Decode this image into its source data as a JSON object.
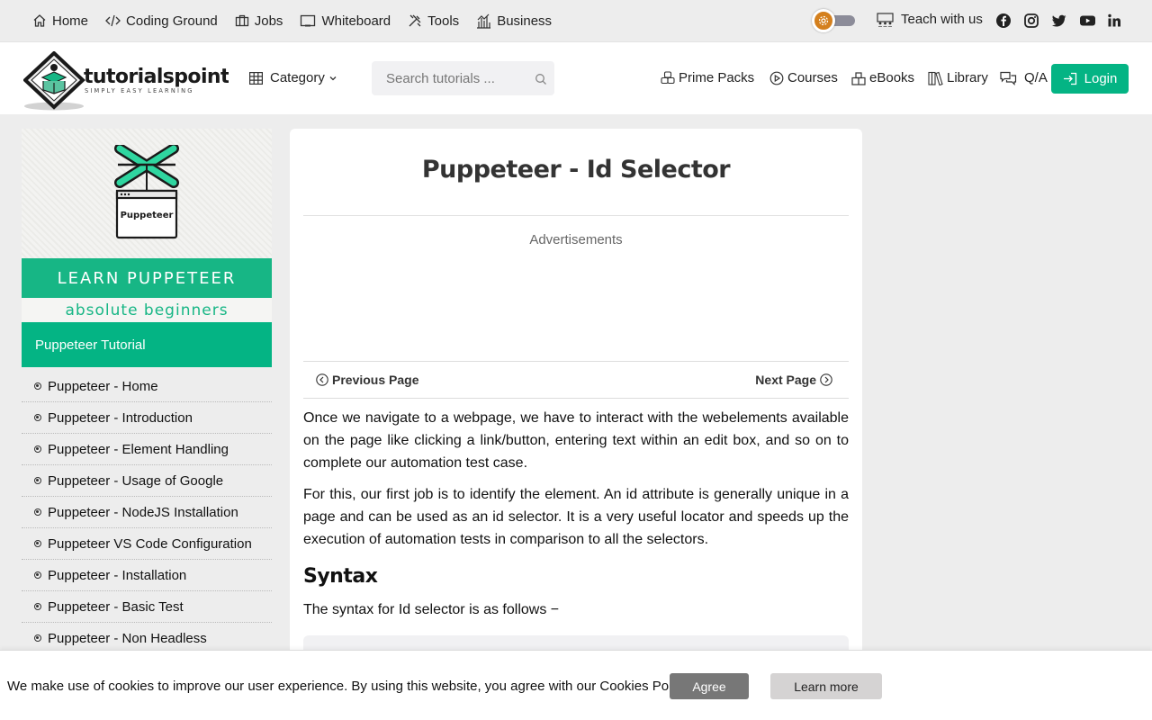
{
  "topnav": {
    "items": [
      {
        "label": "Home",
        "icon": "home-icon"
      },
      {
        "label": "Coding Ground",
        "icon": "code-icon"
      },
      {
        "label": "Jobs",
        "icon": "briefcase-icon"
      },
      {
        "label": "Whiteboard",
        "icon": "whiteboard-icon"
      },
      {
        "label": "Tools",
        "icon": "tools-icon"
      },
      {
        "label": "Business",
        "icon": "chart-icon"
      }
    ],
    "teach_label": "Teach with us",
    "social": [
      "facebook-icon",
      "instagram-icon",
      "twitter-icon",
      "youtube-icon",
      "linkedin-icon"
    ]
  },
  "header": {
    "logo_text": "tutorialspoint",
    "logo_tagline": "SIMPLY EASY LEARNING",
    "category_label": "Category",
    "search_placeholder": "Search tutorials ...",
    "nav": [
      {
        "label": "Prime Packs",
        "icon": "packs-icon"
      },
      {
        "label": "Courses",
        "icon": "play-circle-icon"
      },
      {
        "label": "eBooks",
        "icon": "ebook-icon"
      },
      {
        "label": "Library",
        "icon": "library-icon"
      },
      {
        "label": "Q/A",
        "icon": "chat-icon"
      }
    ],
    "login_label": "Login"
  },
  "sidebar": {
    "banner_title": "LEARN PUPPETEER",
    "banner_subtitle": "absolute beginners",
    "banner_logo_label": "Puppeteer",
    "heading": "Puppeteer Tutorial",
    "items": [
      "Puppeteer - Home",
      "Puppeteer - Introduction",
      "Puppeteer - Element Handling",
      "Puppeteer - Usage of Google",
      "Puppeteer - NodeJS Installation",
      "Puppeteer VS Code Configuration",
      "Puppeteer - Installation",
      "Puppeteer - Basic Test",
      "Puppeteer - Non Headless"
    ]
  },
  "main": {
    "title": "Puppeteer - Id Selector",
    "ads_label": "Advertisements",
    "prev_label": "Previous Page",
    "next_label": "Next Page",
    "paragraphs": [
      "Once we navigate to a webpage, we have to interact with the webelements available on the page like clicking a link/button, entering text within an edit box, and so on to complete our automation test case.",
      "For this, our first job is to identify the element. An id attribute is generally unique in a page and can be used as an id selector. It is a very useful locator and speeds up the execution of automation tests in comparison to all the selectors."
    ],
    "syntax_heading": "Syntax",
    "syntax_text": "The syntax for Id selector is as follows −"
  },
  "cookie": {
    "text": "We make use of cookies to improve our user experience. By using this website, you agree with our Cookies Policy.",
    "agree_label": "Agree",
    "learn_label": "Learn more"
  },
  "colors": {
    "accent": "#04b484",
    "toggle_knob": "#d4801e",
    "background": "#ededed"
  }
}
